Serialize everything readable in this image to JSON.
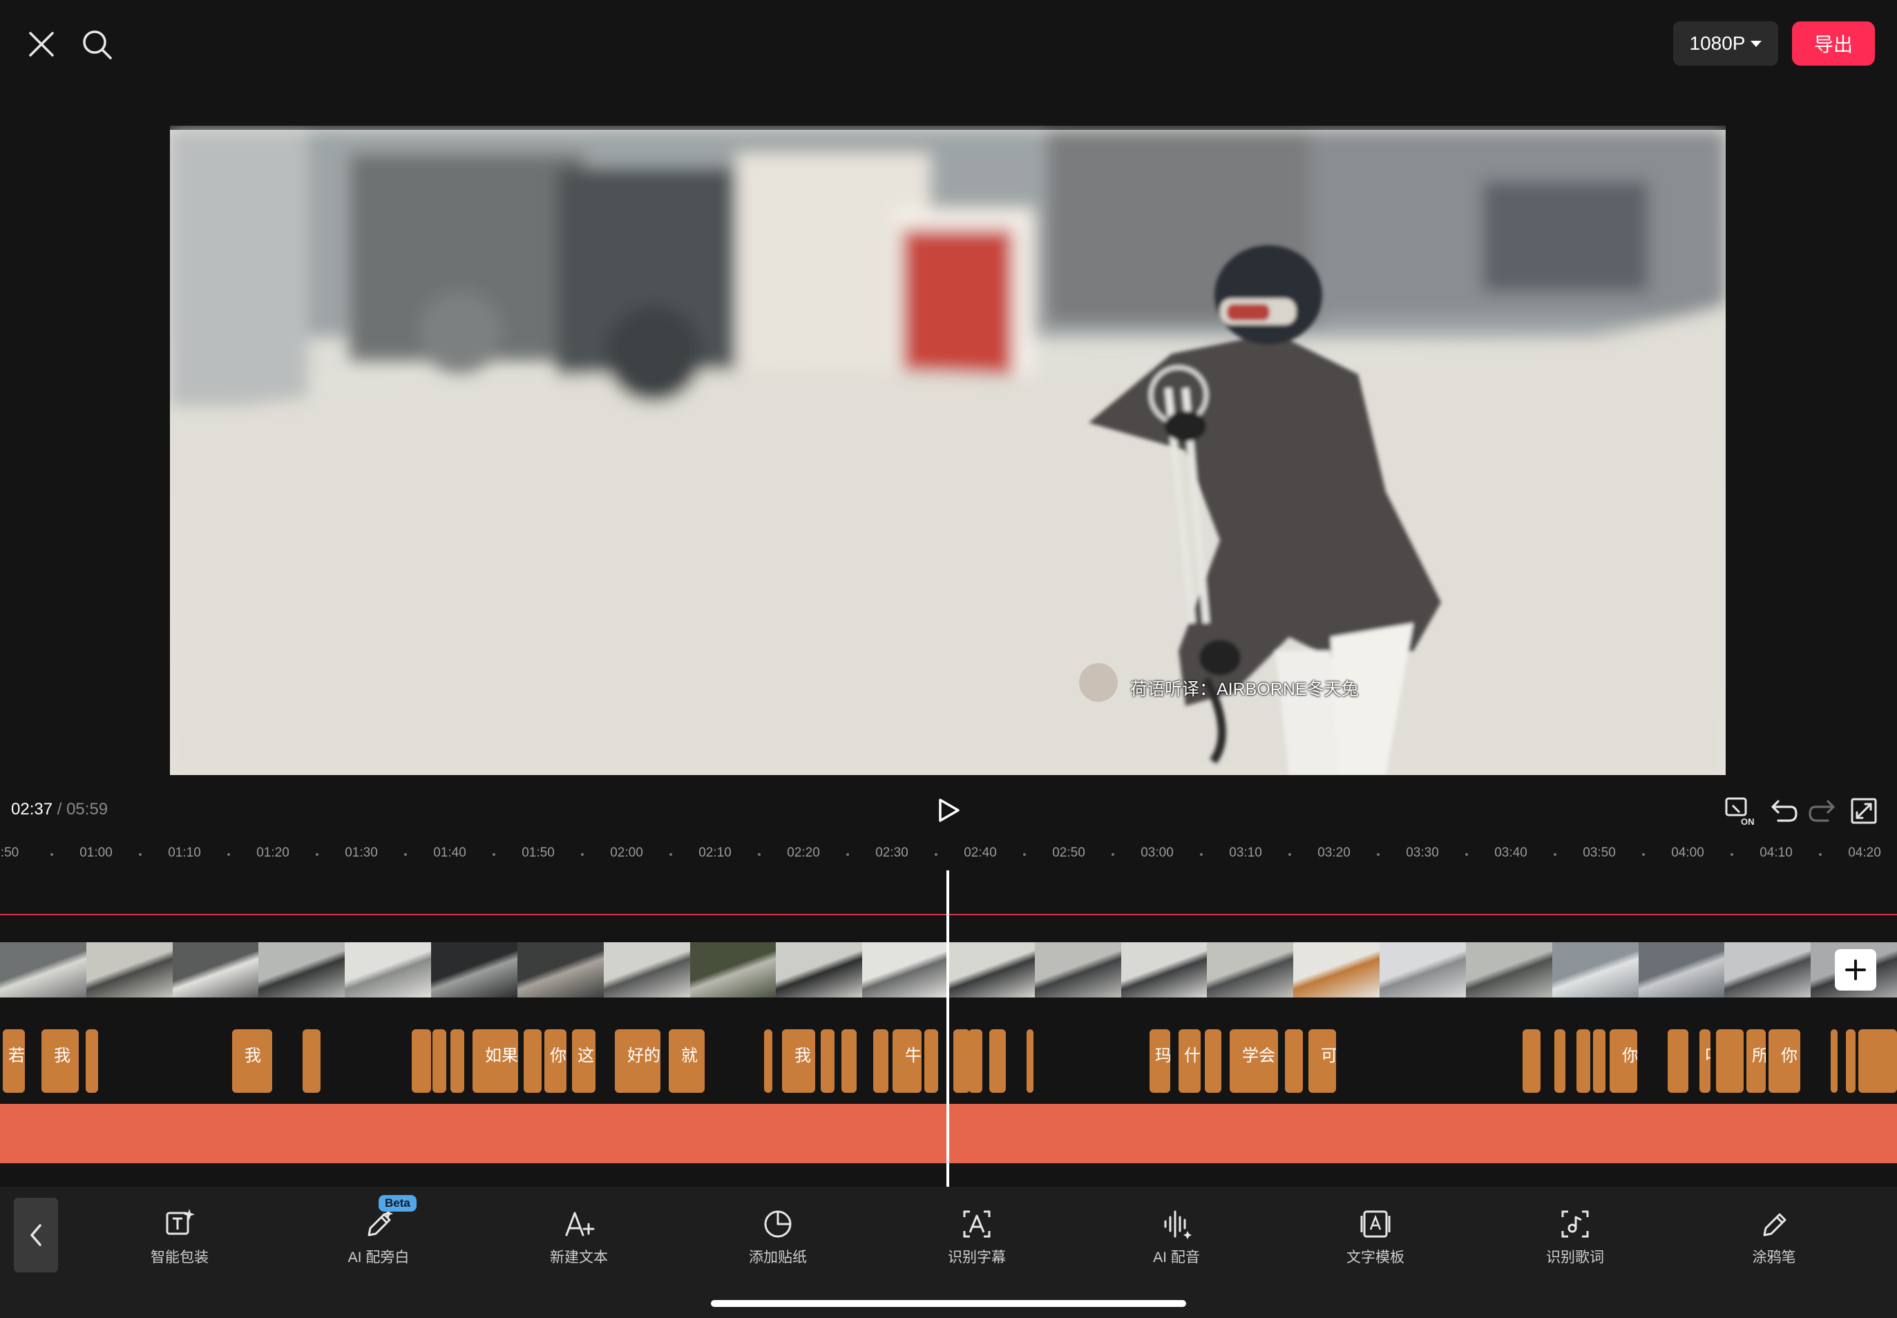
{
  "header": {
    "resolution_label": "1080P",
    "export_label": "导出",
    "icons": [
      "close-icon",
      "search-icon"
    ]
  },
  "preview": {
    "watermark_text": "荷语听译：AIRBORNE冬天兔"
  },
  "playback": {
    "current_time": "02:37",
    "separator": "/",
    "total_time": "05:59",
    "controls": [
      "play-icon",
      "keyframe-on-icon",
      "undo-icon",
      "redo-icon",
      "fullscreen-icon"
    ]
  },
  "ruler": {
    "labels": [
      ":50",
      "01:00",
      "01:10",
      "01:20",
      "01:30",
      "01:40",
      "01:50",
      "02:00",
      "02:10",
      "02:20",
      "02:30",
      "02:40",
      "02:50",
      "03:00",
      "03:10",
      "03:20",
      "03:30",
      "03:40",
      "03:50",
      "04:00",
      "04:10",
      "04:20"
    ]
  },
  "timeline": {
    "video_clip_count": 22,
    "subtitle_clips": [
      "若",
      "我",
      "",
      "我",
      "",
      "",
      "",
      "",
      "如果",
      "",
      "你",
      "这",
      "好的",
      "就",
      "",
      "我",
      "",
      "",
      "",
      "牛",
      "",
      "",
      "",
      "",
      "",
      "玛",
      "什",
      "",
      "学会",
      "",
      "可",
      "",
      "",
      "",
      "",
      "你",
      "",
      "叫",
      "",
      "所",
      "你",
      "",
      "",
      ""
    ],
    "add_clip_icon": "plus-icon"
  },
  "colors": {
    "accent": "#fe2c55",
    "subtitle_clip": "#c97d3b",
    "audio_track": "#e5664c",
    "beta_badge": "#52a7e8"
  },
  "toolbar": {
    "back_icon": "chevron-left-icon",
    "items": [
      {
        "label": "智能包装",
        "icon": "smart-text-icon"
      },
      {
        "label": "AI 配旁白",
        "icon": "ai-pen-icon",
        "badge": "Beta"
      },
      {
        "label": "新建文本",
        "icon": "add-text-icon"
      },
      {
        "label": "添加贴纸",
        "icon": "sticker-icon"
      },
      {
        "label": "识别字幕",
        "icon": "recognize-subtitle-icon"
      },
      {
        "label": "AI 配音",
        "icon": "ai-voice-icon"
      },
      {
        "label": "文字模板",
        "icon": "text-template-icon"
      },
      {
        "label": "识别歌词",
        "icon": "recognize-lyrics-icon"
      },
      {
        "label": "涂鸦笔",
        "icon": "brush-icon"
      }
    ]
  }
}
